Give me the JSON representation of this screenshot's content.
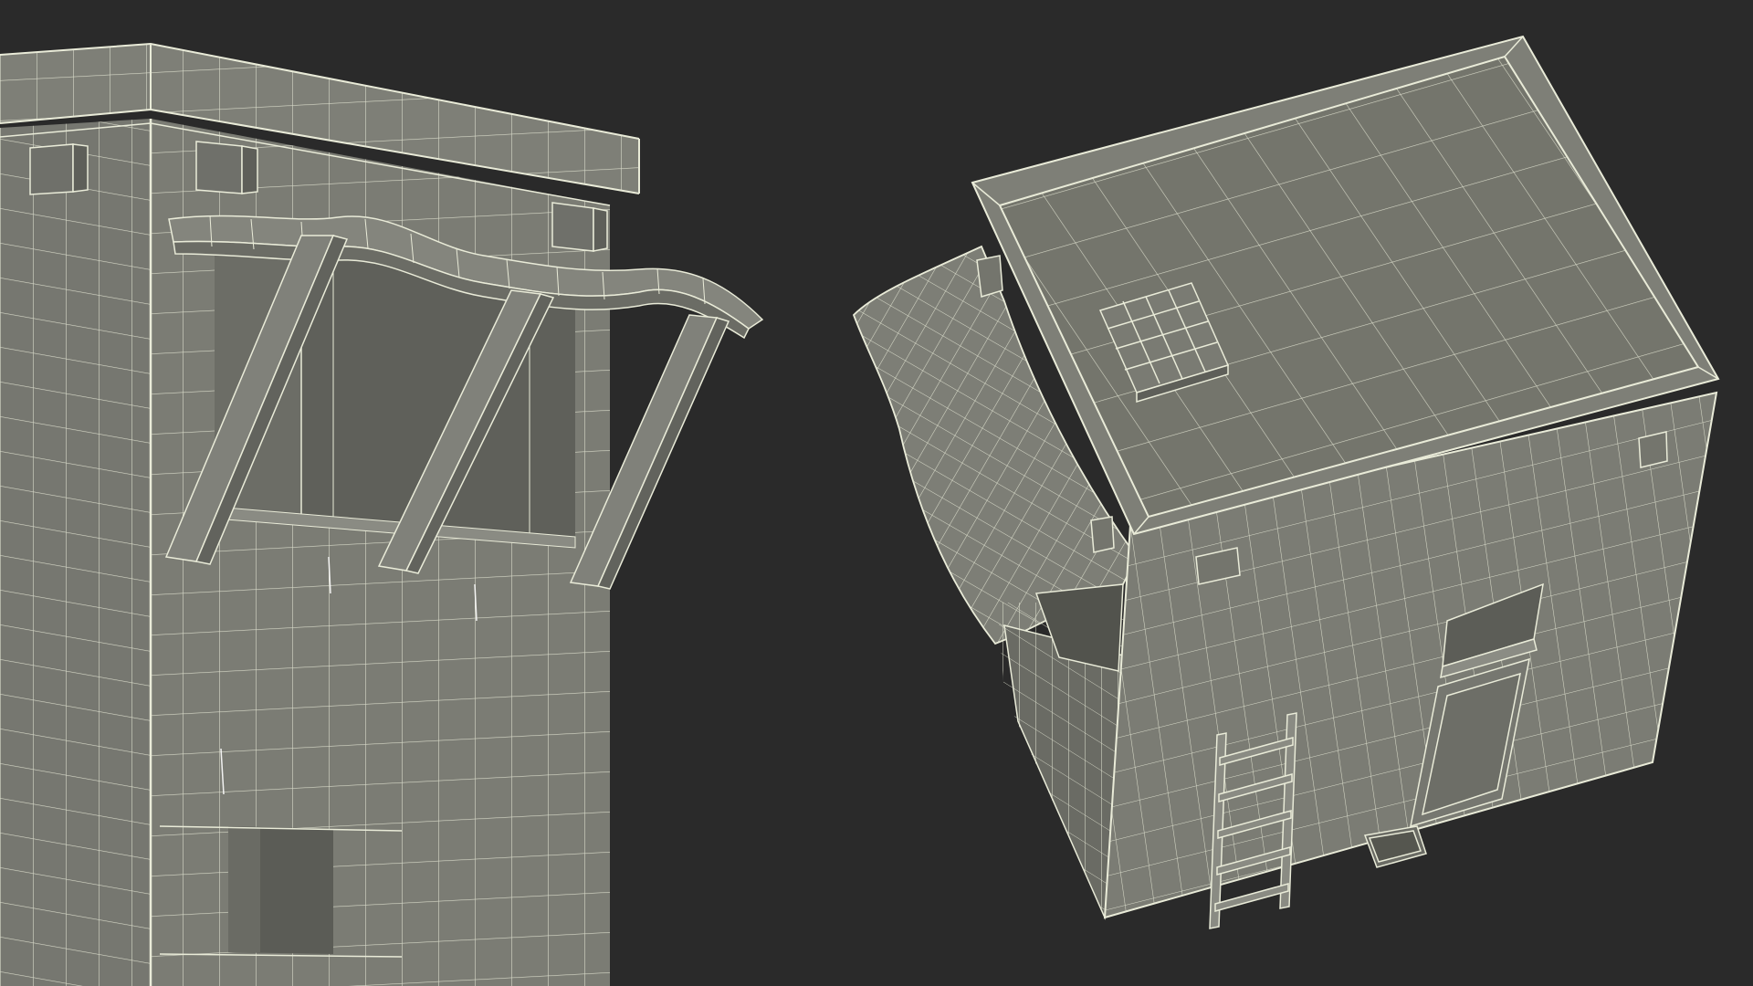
{
  "scene": {
    "background_color": "#2a2a2a",
    "wall_color": "#7a7b72",
    "wall_shade_color": "#686961",
    "wall_dark_color": "#55564f",
    "roof_color": "#74756c",
    "wire_color": "#e9ebd8",
    "views": [
      {
        "name": "close-up-corner-view",
        "shows": [
          "wall",
          "cornice",
          "awning",
          "awning-supports",
          "window",
          "corbels"
        ]
      },
      {
        "name": "top-down-view",
        "shows": [
          "roof",
          "parapet",
          "roof-hatch",
          "awning",
          "window",
          "door",
          "ladder",
          "planter-box"
        ]
      }
    ]
  }
}
